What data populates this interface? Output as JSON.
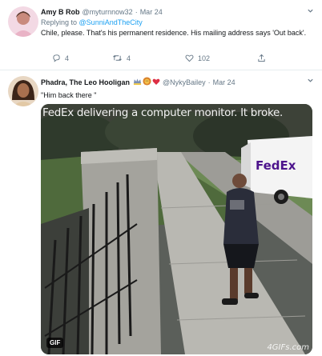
{
  "tweets": [
    {
      "name": "Amy B Rob",
      "handle": "@myturnnow32",
      "date": "Mar 24",
      "replying_to_prefix": "Replying to",
      "replying_to_handle": "@SunniAndTheCity",
      "text": "Chile, please. That's his permanent residence. His mailing address says 'Out back'.",
      "actions": {
        "replies": "4",
        "retweets": "4",
        "likes": "102"
      }
    },
    {
      "name": "Phadra, The Leo Hooligan",
      "handle": "@NykyBailey",
      "date": "Mar 24",
      "text": "\"Him back there \"",
      "media": {
        "caption": "FedEx delivering a computer monitor. It broke.",
        "badge": "GIF",
        "watermark": "4GIFs.com",
        "truck_logo": "FedEx"
      }
    }
  ],
  "colors": {
    "link": "#1da1f2",
    "muted": "#657786",
    "text": "#14171a",
    "like_heart": "#e0245e"
  }
}
